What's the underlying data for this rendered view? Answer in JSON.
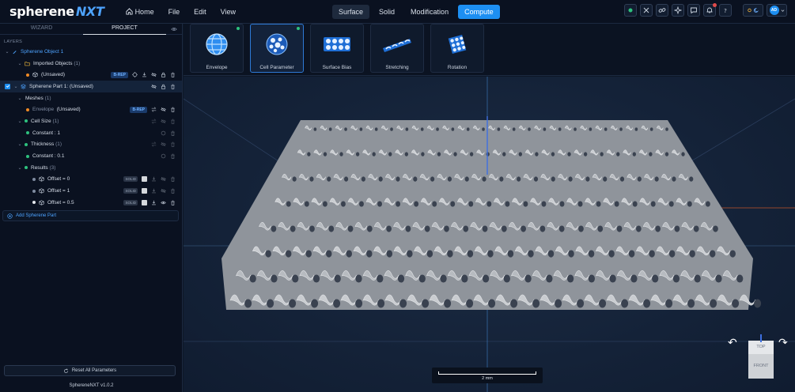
{
  "app": {
    "logo_main": "spherene",
    "logo_accent": "NXT"
  },
  "menu": [
    {
      "label": "Home",
      "icon": "home-icon"
    },
    {
      "label": "File"
    },
    {
      "label": "Edit"
    },
    {
      "label": "View"
    }
  ],
  "modes": [
    {
      "label": "Surface",
      "active": true
    },
    {
      "label": "Solid"
    },
    {
      "label": "Modification"
    },
    {
      "label": "Compute",
      "primary": true
    }
  ],
  "toolbar_icons": [
    "status-dot-icon",
    "crossed-tools-icon",
    "link-icon",
    "sparkle-icon",
    "comment-icon",
    "bell-icon",
    "help-icon",
    "theme-toggle-icon",
    "avatar"
  ],
  "user": {
    "initials": "AD"
  },
  "sidebar": {
    "tabs": [
      {
        "label": "WIZARD"
      },
      {
        "label": "PROJECT",
        "active": true
      }
    ],
    "layers_label": "LAYERS",
    "tree": {
      "object": "Spherene Object 1",
      "imported": "Imported Objects",
      "imported_count": "(1)",
      "unsaved": "(Unsaved)",
      "brep": "B-REP",
      "part": "Spherene Part 1: (Unsaved)",
      "meshes": "Meshes",
      "meshes_count": "(1)",
      "envelope": "Envelope",
      "envelope_state": "(Unsaved)",
      "cell_size": "Cell Size",
      "cell_size_count": "(1)",
      "constant_1": "Constant : 1",
      "thickness": "Thickness",
      "thickness_count": "(1)",
      "constant_01": "Constant : 0.1",
      "results": "Results",
      "results_count": "(3)",
      "offsets": [
        "Offset = 0",
        "Offset = 1",
        "Offset = 0.5"
      ],
      "solid": "SOLID"
    },
    "add_part": "Add Spherene Part",
    "reset": "Reset All Parameters",
    "version": "SphereneNXT v1.0.2"
  },
  "tools": [
    {
      "label": "Envelope",
      "status": true
    },
    {
      "label": "Cell Parameter",
      "active": true,
      "status": true
    },
    {
      "label": "Surface Bias"
    },
    {
      "label": "Stretching"
    },
    {
      "label": "Rotation"
    }
  ],
  "viewport": {
    "scale_label": "2 mm",
    "cube_top": "TOP",
    "cube_front": "FRONT",
    "lattice_rows": 8,
    "lattice_cols": 24
  },
  "colors": {
    "accent": "#1d8ff2",
    "bg": "#0d1726",
    "lattice": "#b9bcc0",
    "green": "#2ec27e",
    "orange": "#f08a24"
  }
}
